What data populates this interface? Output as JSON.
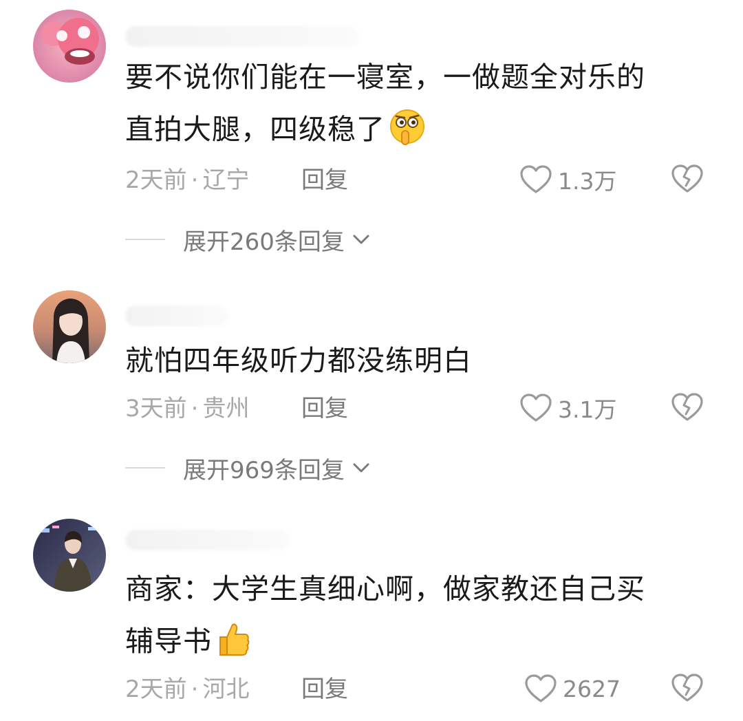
{
  "comments": [
    {
      "text_line1": "要不说你们能在一寝室，一做题全对乐的",
      "text_line2": "直拍大腿，四级稳了",
      "emoji": "shushing-face",
      "time": "2天前",
      "location": "辽宁",
      "reply_label": "回复",
      "likes": "1.3万",
      "expand_label": "展开260条回复"
    },
    {
      "text_line1": "就怕四年级听力都没练明白",
      "time": "3天前",
      "location": "贵州",
      "reply_label": "回复",
      "likes": "3.1万",
      "expand_label": "展开969条回复"
    },
    {
      "text_line1": "商家：大学生真细心啊，做家教还自己买",
      "text_line2": "辅导书",
      "emoji": "thumbs-up",
      "time": "2天前",
      "location": "河北",
      "reply_label": "回复",
      "likes": "2627"
    }
  ],
  "icons": {
    "like": "heart-outline-icon",
    "dislike": "broken-heart-icon",
    "expand": "chevron-down-icon"
  },
  "colors": {
    "text_primary": "#1a1a1a",
    "text_meta": "#a8a8a8",
    "text_secondary": "#7a7a7a"
  }
}
